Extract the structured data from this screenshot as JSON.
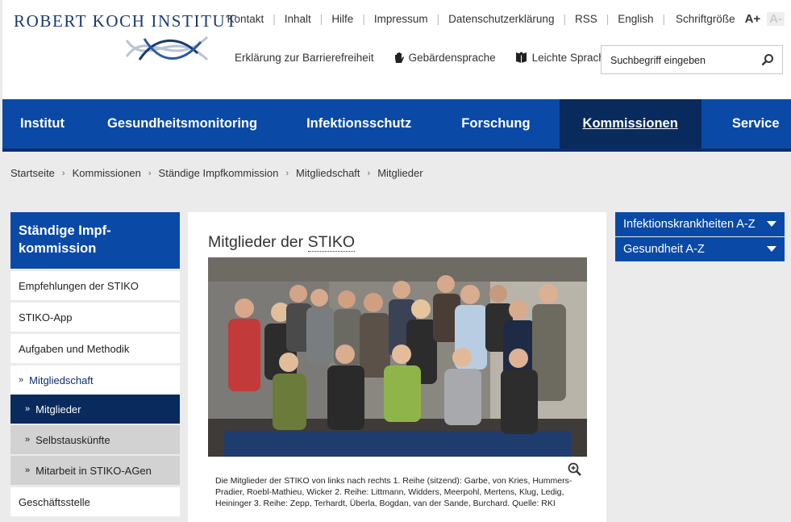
{
  "header": {
    "logo_text": "ROBERT KOCH INSTITUT",
    "topnav": [
      "Kontakt",
      "Inhalt",
      "Hilfe",
      "Impressum",
      "Datenschutzerklärung",
      "RSS",
      "English"
    ],
    "font_size_label": "Schriftgröße",
    "font_increase": "A+",
    "font_decrease": "A-",
    "accessibility": "Erklärung zur Barrierefreiheit",
    "sign_language": "Gebärdensprache",
    "easy_language": "Leichte Sprache",
    "search_placeholder": "Suchbegriff eingeben"
  },
  "mainnav": [
    {
      "label": "Institut",
      "active": false
    },
    {
      "label": "Gesundheitsmonitoring",
      "active": false
    },
    {
      "label": "Infektionsschutz",
      "active": false
    },
    {
      "label": "Forschung",
      "active": false
    },
    {
      "label": "Kommissionen",
      "active": true
    },
    {
      "label": "Service",
      "active": false
    }
  ],
  "breadcrumb": [
    "Startseite",
    "Kommissionen",
    "Ständige Impfkommission",
    "Mitgliedschaft",
    "Mitglieder"
  ],
  "sidebar": {
    "title": "Ständige Impf-kommission",
    "items": [
      "Empfehlungen der STIKO",
      "STIKO-App",
      "Aufgaben und Methodik"
    ],
    "open_item": "Mitgliedschaft",
    "sub_items": [
      "Mitglieder",
      "Selbstauskünfte",
      "Mitarbeit in STIKO-AGen"
    ],
    "last_item": "Geschäftsstelle"
  },
  "content": {
    "title_prefix": "Mitglieder der",
    "title_abbr": "STIKO",
    "caption": "Die Mitglieder der STIKO von links nach rechts 1. Reihe (sitzend): Garbe, von Kries, Hummers-Pradier, Roebl-Mathieu, Wicker 2. Reihe: Littmann, Widders, Meerpohl, Mertens, Klug, Ledig, Heininger 3. Reihe: Zepp, Terhardt, Überla, Bogdan, van der Sande, Burchard. Quelle: RKI"
  },
  "right_sidebar": [
    "Infektionskrankheiten A-Z",
    "Gesundheit A-Z"
  ],
  "colors": {
    "primary": "#0a4aa6",
    "dark": "#092a5c",
    "background": "#ebebeb"
  }
}
